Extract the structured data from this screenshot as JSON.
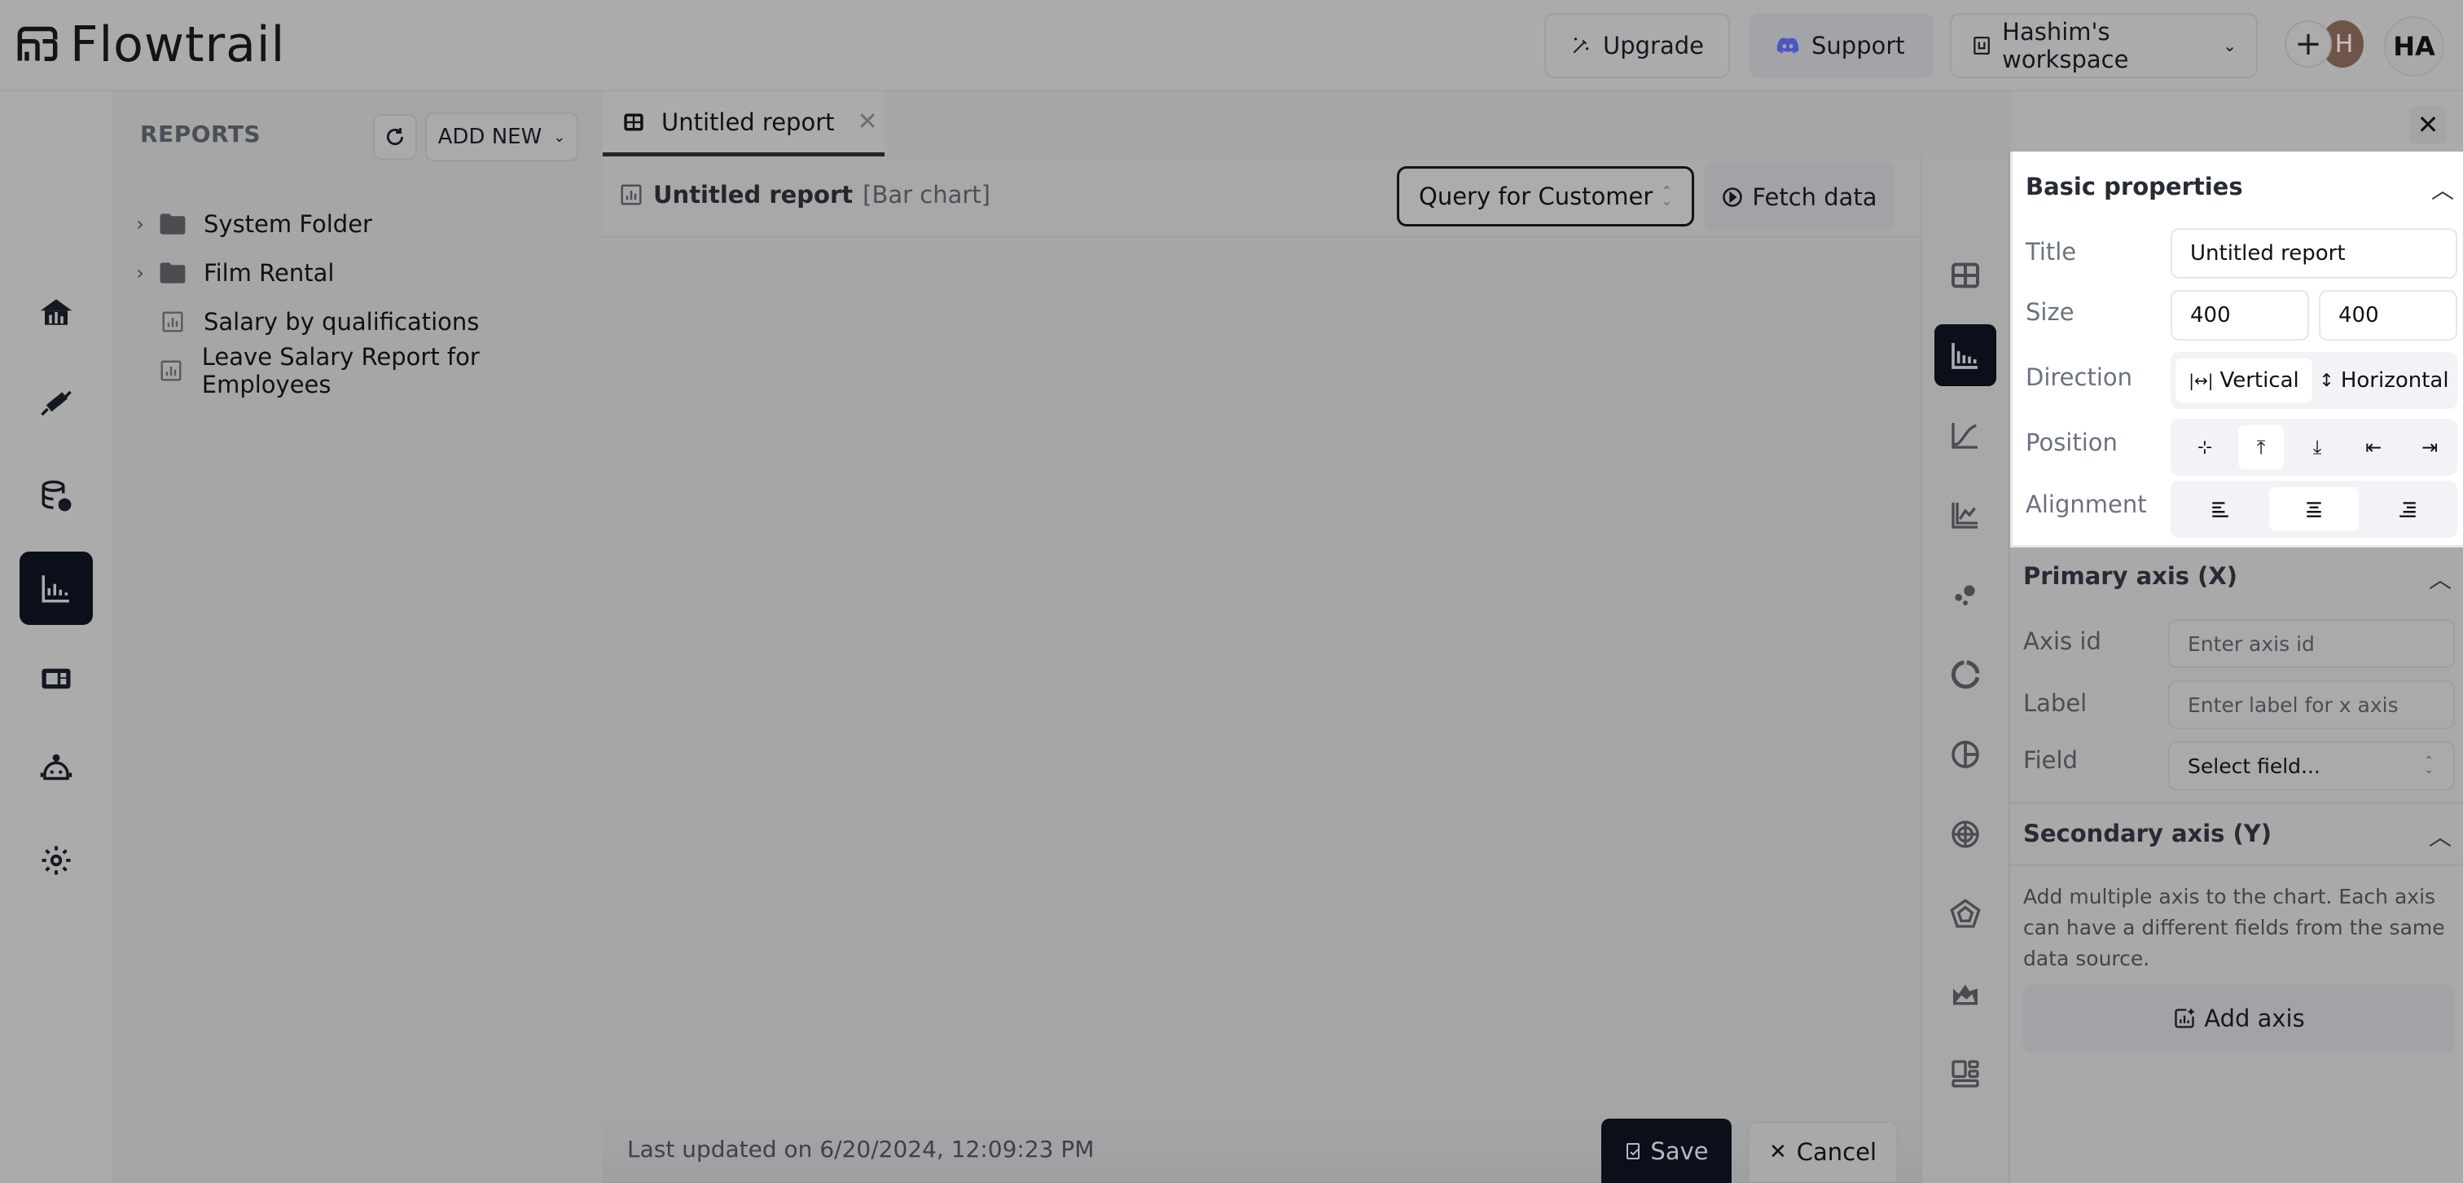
{
  "app": {
    "name": "Flowtrail"
  },
  "header": {
    "upgrade_label": "Upgrade",
    "support_label": "Support",
    "workspace_label": "Hashim's workspace",
    "add_member_symbol": "+",
    "member_avatar_initial": "H",
    "user_initials": "HA",
    "colors": {
      "support_icon": "#5865F2",
      "member_avatar": "#6e5449"
    }
  },
  "rail": {
    "items": [
      {
        "name": "home",
        "icon": "home-chart-icon",
        "active": false
      },
      {
        "name": "connections",
        "icon": "plug-icon",
        "active": false
      },
      {
        "name": "data-sources",
        "icon": "database-gear-icon",
        "active": false
      },
      {
        "name": "reports",
        "icon": "bar-chart-icon",
        "active": true
      },
      {
        "name": "dashboards",
        "icon": "dashboard-icon",
        "active": false
      },
      {
        "name": "ai-assistant",
        "icon": "robot-icon",
        "active": false
      },
      {
        "name": "settings",
        "icon": "gear-icon",
        "active": false
      }
    ]
  },
  "sidebar": {
    "title": "REPORTS",
    "add_new_label": "ADD NEW",
    "items": [
      {
        "label": "System Folder",
        "type": "folder"
      },
      {
        "label": "Film Rental",
        "type": "folder"
      },
      {
        "label": "Salary by qualifications",
        "type": "report"
      },
      {
        "label": "Leave Salary Report for Employees",
        "type": "report"
      }
    ]
  },
  "tabs": [
    {
      "label": "Untitled report",
      "active": true
    }
  ],
  "report": {
    "title": "Untitled report",
    "type_label": "[Bar chart]",
    "query_select_value": "Query for Customer R",
    "fetch_label": "Fetch data",
    "last_updated": "Last updated on 6/20/2024, 12:09:23 PM",
    "save_label": "Save",
    "cancel_label": "Cancel"
  },
  "chart_types": [
    {
      "name": "table",
      "active": false
    },
    {
      "name": "bar",
      "active": true
    },
    {
      "name": "line",
      "active": false
    },
    {
      "name": "multi-line",
      "active": false
    },
    {
      "name": "scatter",
      "active": false
    },
    {
      "name": "doughnut",
      "active": false
    },
    {
      "name": "pie",
      "active": false
    },
    {
      "name": "polar",
      "active": false
    },
    {
      "name": "radar",
      "active": false
    },
    {
      "name": "area",
      "active": false
    },
    {
      "name": "layout",
      "active": false
    }
  ],
  "properties": {
    "basic": {
      "title": "Basic properties",
      "title_label": "Title",
      "title_value": "Untitled report",
      "size_label": "Size",
      "width_value": "400",
      "height_value": "400",
      "direction_label": "Direction",
      "direction_options": [
        "Vertical",
        "Horizontal"
      ],
      "direction_selected": "Vertical",
      "position_label": "Position",
      "position_options": [
        "center",
        "top",
        "bottom",
        "left",
        "right"
      ],
      "position_selected": "top",
      "alignment_label": "Alignment",
      "alignment_options": [
        "left",
        "center",
        "right"
      ],
      "alignment_selected": "center"
    },
    "primary_axis": {
      "title": "Primary axis (X)",
      "axis_id_label": "Axis id",
      "axis_id_placeholder": "Enter axis id",
      "label_label": "Label",
      "label_placeholder": "Enter label for x axis",
      "field_label": "Field",
      "field_value": "Select field..."
    },
    "secondary_axis": {
      "title": "Secondary axis (Y)",
      "help_text": "Add multiple axis to the chart. Each axis can have a different fields from the same data source.",
      "add_axis_label": "Add axis"
    }
  }
}
